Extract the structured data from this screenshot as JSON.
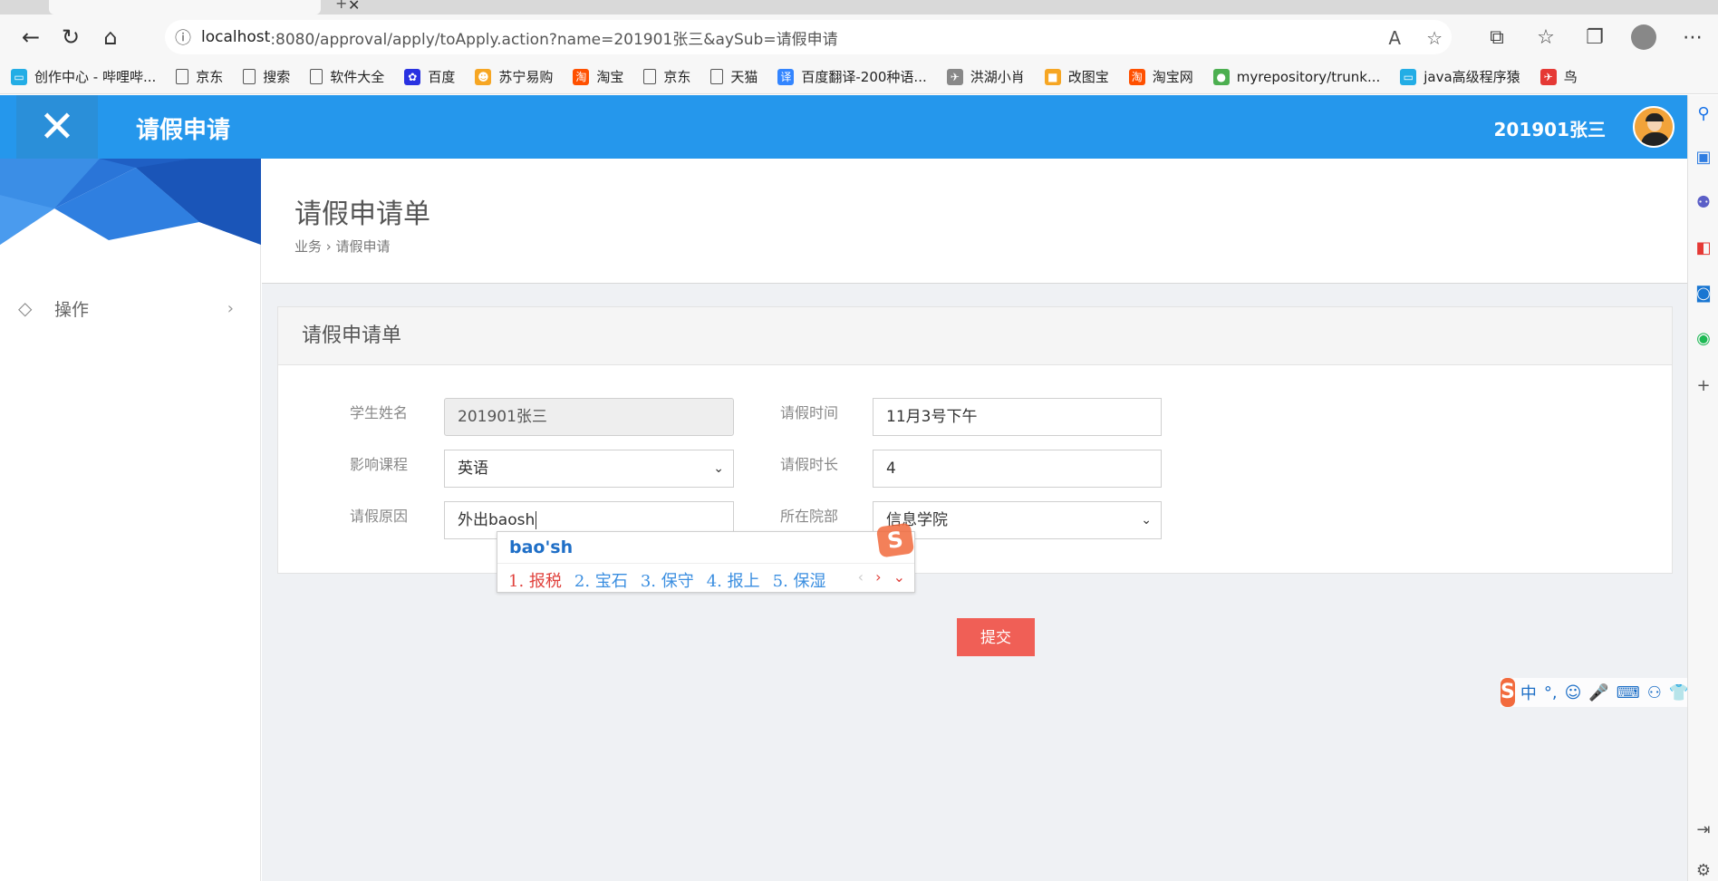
{
  "browser": {
    "url_host": "localhost",
    "url_path": ":8080/approval/apply/toApply.action?name=201901张三&aySub=请假申请",
    "bookmarks": [
      {
        "label": "创作中心 - 哔哩哔...",
        "icon": "bilibili-icon",
        "color": "#23ade5"
      },
      {
        "label": "京东",
        "icon": "page-icon"
      },
      {
        "label": "搜索",
        "icon": "page-icon"
      },
      {
        "label": "软件大全",
        "icon": "page-icon"
      },
      {
        "label": "百度",
        "icon": "baidu-icon",
        "color": "#2932e1"
      },
      {
        "label": "苏宁易购",
        "icon": "suning-icon",
        "color": "#f6a623"
      },
      {
        "label": "淘宝",
        "icon": "taobao-icon",
        "color": "#ff5000"
      },
      {
        "label": "京东",
        "icon": "page-icon"
      },
      {
        "label": "天猫",
        "icon": "page-icon"
      },
      {
        "label": "百度翻译-200种语...",
        "icon": "translate-icon",
        "color": "#3385ff"
      },
      {
        "label": "洪湖小肖",
        "icon": "bird-icon",
        "color": "#888888"
      },
      {
        "label": "改图宝",
        "icon": "gaitubao-icon",
        "color": "#f6a623"
      },
      {
        "label": "淘宝网",
        "icon": "taobao-icon",
        "color": "#ff5000"
      },
      {
        "label": "myrepository/trunk...",
        "icon": "chrome-icon",
        "color": "#4caf50"
      },
      {
        "label": "java高级程序猿",
        "icon": "bilibili-icon",
        "color": "#23ade5"
      },
      {
        "label": "鸟",
        "icon": "bird-icon",
        "color": "#e53935"
      }
    ]
  },
  "header": {
    "title": "请假申请",
    "user_name": "201901张三",
    "bg_color": "#2597ec"
  },
  "sidebar": {
    "menu_label": "操作"
  },
  "page": {
    "title": "请假申请单",
    "breadcrumb": "业务 › 请假申请"
  },
  "form": {
    "panel_title": "请假申请单",
    "student_name_label": "学生姓名",
    "student_name_value": "201901张三",
    "leave_time_label": "请假时间",
    "leave_time_value": "11月3号下午",
    "course_label": "影响课程",
    "course_value": "英语",
    "duration_label": "请假时长",
    "duration_value": "4",
    "reason_label": "请假原因",
    "reason_value": "外出baosh",
    "dept_label": "所在院部",
    "dept_value": "信息学院",
    "submit_label": "提交",
    "submit_color": "#f05f56"
  },
  "ime": {
    "composition": "bao'sh",
    "candidates": [
      "1. 报税",
      "2. 宝石",
      "3. 保守",
      "4. 报上",
      "5. 保湿"
    ],
    "logo": "S"
  },
  "ime_bar": {
    "mode": "中",
    "punct": "°,"
  }
}
